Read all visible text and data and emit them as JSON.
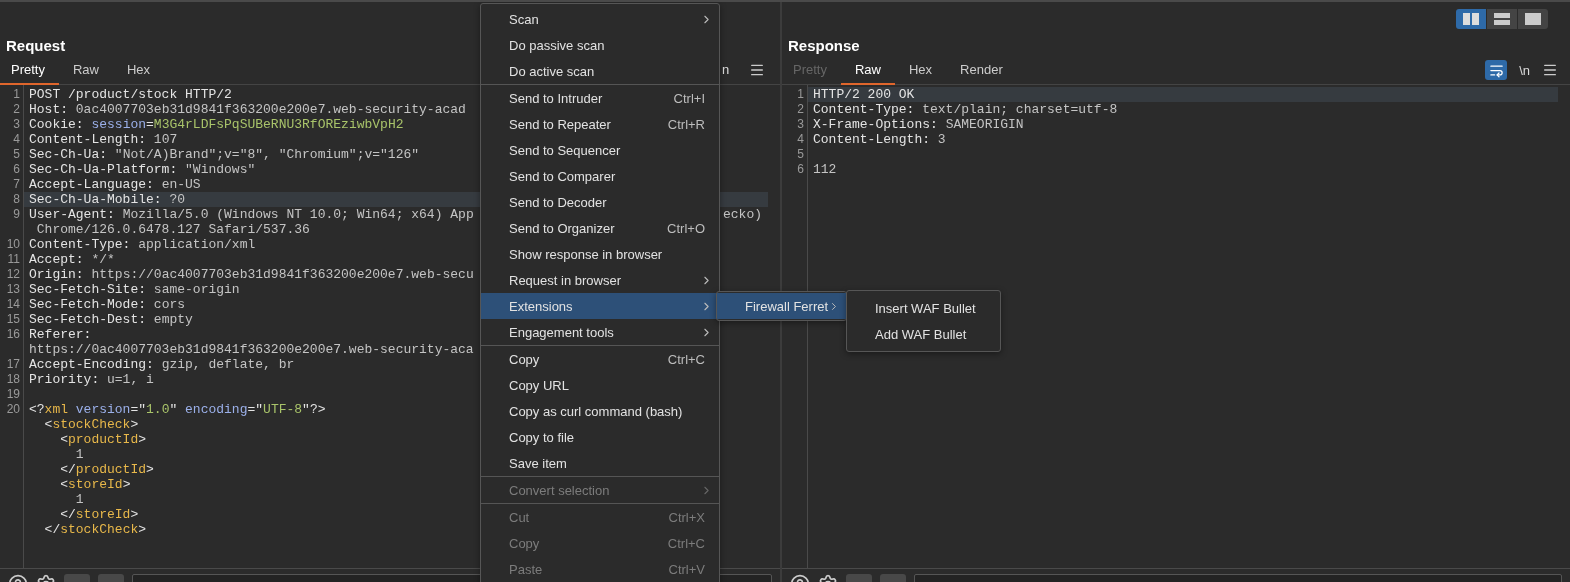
{
  "layout_buttons": [
    {
      "kind": "columns",
      "selected": true
    },
    {
      "kind": "rows",
      "selected": false
    },
    {
      "kind": "single",
      "selected": false
    }
  ],
  "request": {
    "title": "Request",
    "tabs": [
      {
        "label": "Pretty",
        "selected": true,
        "disabled": false
      },
      {
        "label": "Raw",
        "selected": false,
        "disabled": false
      },
      {
        "label": "Hex",
        "selected": false,
        "disabled": false
      }
    ],
    "newline_label": "n",
    "lines": [
      {
        "num": "1",
        "selected": false,
        "segments": [
          {
            "text": "POST /product/stock HTTP/2",
            "kind": "name"
          }
        ]
      },
      {
        "num": "2",
        "selected": false,
        "segments": [
          {
            "text": "Host: ",
            "kind": "name"
          },
          {
            "text": "0ac4007703eb31d9841f363200e200e7.web-security-acad",
            "kind": "value"
          }
        ]
      },
      {
        "num": "3",
        "selected": false,
        "segments": [
          {
            "text": "Cookie: ",
            "kind": "name"
          },
          {
            "text": "session",
            "kind": "blue"
          },
          {
            "text": "=",
            "kind": "name"
          },
          {
            "text": "M3G4rLDFsPqSUBeRNU3RfOREziwbVpH2",
            "kind": "green"
          }
        ]
      },
      {
        "num": "4",
        "selected": false,
        "segments": [
          {
            "text": "Content-Length: ",
            "kind": "name"
          },
          {
            "text": "107",
            "kind": "value"
          }
        ]
      },
      {
        "num": "5",
        "selected": false,
        "segments": [
          {
            "text": "Sec-Ch-Ua: ",
            "kind": "name"
          },
          {
            "text": "\"Not/A)Brand\";v=\"8\", \"Chromium\";v=\"126\"",
            "kind": "value"
          }
        ]
      },
      {
        "num": "6",
        "selected": false,
        "segments": [
          {
            "text": "Sec-Ch-Ua-Platform: ",
            "kind": "name"
          },
          {
            "text": "\"Windows\"",
            "kind": "value"
          }
        ]
      },
      {
        "num": "7",
        "selected": false,
        "segments": [
          {
            "text": "Accept-Language: ",
            "kind": "name"
          },
          {
            "text": "en-US",
            "kind": "value"
          }
        ]
      },
      {
        "num": "8",
        "selected": true,
        "segments": [
          {
            "text": "Sec-Ch-Ua-Mobile: ",
            "kind": "name"
          },
          {
            "text": "?0",
            "kind": "value"
          }
        ]
      },
      {
        "num": "9",
        "selected": false,
        "segments": [
          {
            "text": "User-Agent: ",
            "kind": "name"
          },
          {
            "text": "Mozilla/5.0 (Windows NT 10.0; Win64; x64) App",
            "kind": "value"
          }
        ],
        "tail": "ecko)"
      },
      {
        "selected": false,
        "segments": [
          {
            "text": " Chrome/126.0.6478.127 Safari/537.36",
            "kind": "value"
          }
        ]
      },
      {
        "num": "10",
        "selected": false,
        "segments": [
          {
            "text": "Content-Type: ",
            "kind": "name"
          },
          {
            "text": "application/xml",
            "kind": "value"
          }
        ]
      },
      {
        "num": "11",
        "selected": false,
        "segments": [
          {
            "text": "Accept: ",
            "kind": "name"
          },
          {
            "text": "*/*",
            "kind": "value"
          }
        ]
      },
      {
        "num": "12",
        "selected": false,
        "segments": [
          {
            "text": "Origin: ",
            "kind": "name"
          },
          {
            "text": "https://0ac4007703eb31d9841f363200e200e7.web-secu",
            "kind": "value"
          }
        ]
      },
      {
        "num": "13",
        "selected": false,
        "segments": [
          {
            "text": "Sec-Fetch-Site: ",
            "kind": "name"
          },
          {
            "text": "same-origin",
            "kind": "value"
          }
        ]
      },
      {
        "num": "14",
        "selected": false,
        "segments": [
          {
            "text": "Sec-Fetch-Mode: ",
            "kind": "name"
          },
          {
            "text": "cors",
            "kind": "value"
          }
        ]
      },
      {
        "num": "15",
        "selected": false,
        "segments": [
          {
            "text": "Sec-Fetch-Dest: ",
            "kind": "name"
          },
          {
            "text": "empty",
            "kind": "value"
          }
        ]
      },
      {
        "num": "16",
        "selected": false,
        "segments": [
          {
            "text": "Referer:",
            "kind": "name"
          }
        ]
      },
      {
        "selected": false,
        "segments": [
          {
            "text": "https://0ac4007703eb31d9841f363200e200e7.web-security-aca",
            "kind": "value"
          }
        ]
      },
      {
        "num": "17",
        "selected": false,
        "segments": [
          {
            "text": "Accept-Encoding: ",
            "kind": "name"
          },
          {
            "text": "gzip, deflate, br",
            "kind": "value"
          }
        ]
      },
      {
        "num": "18",
        "selected": false,
        "segments": [
          {
            "text": "Priority: ",
            "kind": "name"
          },
          {
            "text": "u=1, i",
            "kind": "value"
          }
        ]
      },
      {
        "num": "19",
        "selected": false
      },
      {
        "num": "20",
        "selected": false,
        "segments": [
          {
            "text": "<?",
            "kind": "name"
          },
          {
            "text": "xml",
            "kind": "tag"
          },
          {
            "text": " version",
            "kind": "blue"
          },
          {
            "text": "=\"",
            "kind": "name"
          },
          {
            "text": "1.0",
            "kind": "green"
          },
          {
            "text": "\" ",
            "kind": "name"
          },
          {
            "text": "encoding",
            "kind": "blue"
          },
          {
            "text": "=\"",
            "kind": "name"
          },
          {
            "text": "UTF-8",
            "kind": "green"
          },
          {
            "text": "\"?>",
            "kind": "name"
          }
        ]
      },
      {
        "selected": false,
        "segments": [
          {
            "text": "  <",
            "kind": "name"
          },
          {
            "text": "stockCheck",
            "kind": "tag"
          },
          {
            "text": ">",
            "kind": "name"
          }
        ]
      },
      {
        "selected": false,
        "segments": [
          {
            "text": "    <",
            "kind": "name"
          },
          {
            "text": "productId",
            "kind": "tag"
          },
          {
            "text": ">",
            "kind": "name"
          }
        ]
      },
      {
        "selected": false,
        "segments": [
          {
            "text": "      1",
            "kind": "value"
          }
        ]
      },
      {
        "selected": false,
        "segments": [
          {
            "text": "    </",
            "kind": "name"
          },
          {
            "text": "productId",
            "kind": "tag"
          },
          {
            "text": ">",
            "kind": "name"
          }
        ]
      },
      {
        "selected": false,
        "segments": [
          {
            "text": "    <",
            "kind": "name"
          },
          {
            "text": "storeId",
            "kind": "tag"
          },
          {
            "text": ">",
            "kind": "name"
          }
        ]
      },
      {
        "selected": false,
        "segments": [
          {
            "text": "      1",
            "kind": "value"
          }
        ]
      },
      {
        "selected": false,
        "segments": [
          {
            "text": "    </",
            "kind": "name"
          },
          {
            "text": "storeId",
            "kind": "tag"
          },
          {
            "text": ">",
            "kind": "name"
          }
        ]
      },
      {
        "selected": false,
        "segments": [
          {
            "text": "  </",
            "kind": "name"
          },
          {
            "text": "stockCheck",
            "kind": "tag"
          },
          {
            "text": ">",
            "kind": "name"
          }
        ]
      }
    ]
  },
  "response": {
    "title": "Response",
    "tabs": [
      {
        "label": "Pretty",
        "selected": false,
        "disabled": true
      },
      {
        "label": "Raw",
        "selected": true,
        "disabled": false
      },
      {
        "label": "Hex",
        "selected": false,
        "disabled": false
      },
      {
        "label": "Render",
        "selected": false,
        "disabled": false
      }
    ],
    "wrap_on": true,
    "newline_label": "\\n",
    "lines": [
      {
        "num": "1",
        "selected": true,
        "segments": [
          {
            "text": "HTTP/2 200 OK",
            "kind": "name"
          }
        ]
      },
      {
        "num": "2",
        "selected": false,
        "segments": [
          {
            "text": "Content-Type: ",
            "kind": "name"
          },
          {
            "text": "text/plain; charset=utf-8",
            "kind": "value"
          }
        ]
      },
      {
        "num": "3",
        "selected": false,
        "segments": [
          {
            "text": "X-Frame-Options: ",
            "kind": "name"
          },
          {
            "text": "SAMEORIGIN",
            "kind": "value"
          }
        ]
      },
      {
        "num": "4",
        "selected": false,
        "segments": [
          {
            "text": "Content-Length: ",
            "kind": "name"
          },
          {
            "text": "3",
            "kind": "value"
          }
        ]
      },
      {
        "num": "5",
        "selected": false
      },
      {
        "num": "6",
        "selected": false,
        "segments": [
          {
            "text": "112",
            "kind": "value"
          }
        ]
      }
    ]
  },
  "context_menu": {
    "items": [
      {
        "kind": "item",
        "label": "Scan",
        "submenu": true,
        "selected": false,
        "disabled": false
      },
      {
        "kind": "item",
        "label": "Do passive scan",
        "selected": false,
        "disabled": false
      },
      {
        "kind": "item",
        "label": "Do active scan",
        "selected": false,
        "disabled": false
      },
      {
        "kind": "separator"
      },
      {
        "kind": "item",
        "label": "Send to Intruder",
        "shortcut": "Ctrl+I",
        "selected": false,
        "disabled": false
      },
      {
        "kind": "item",
        "label": "Send to Repeater",
        "shortcut": "Ctrl+R",
        "selected": false,
        "disabled": false
      },
      {
        "kind": "item",
        "label": "Send to Sequencer",
        "selected": false,
        "disabled": false
      },
      {
        "kind": "item",
        "label": "Send to Comparer",
        "selected": false,
        "disabled": false
      },
      {
        "kind": "item",
        "label": "Send to Decoder",
        "selected": false,
        "disabled": false
      },
      {
        "kind": "item",
        "label": "Send to Organizer",
        "shortcut": "Ctrl+O",
        "selected": false,
        "disabled": false
      },
      {
        "kind": "item",
        "label": "Show response in browser",
        "selected": false,
        "disabled": false
      },
      {
        "kind": "item",
        "label": "Request in browser",
        "submenu": true,
        "selected": false,
        "disabled": false
      },
      {
        "kind": "item",
        "label": "Extensions",
        "submenu": true,
        "selected": true,
        "disabled": false
      },
      {
        "kind": "item",
        "label": "Engagement tools",
        "submenu": true,
        "selected": false,
        "disabled": false
      },
      {
        "kind": "separator"
      },
      {
        "kind": "item",
        "label": "Copy",
        "shortcut": "Ctrl+C",
        "selected": false,
        "disabled": false
      },
      {
        "kind": "item",
        "label": "Copy URL",
        "selected": false,
        "disabled": false
      },
      {
        "kind": "item",
        "label": "Copy as curl command (bash)",
        "selected": false,
        "disabled": false
      },
      {
        "kind": "item",
        "label": "Copy to file",
        "selected": false,
        "disabled": false
      },
      {
        "kind": "item",
        "label": "Save item",
        "selected": false,
        "disabled": false
      },
      {
        "kind": "separator"
      },
      {
        "kind": "item",
        "label": "Convert selection",
        "submenu": true,
        "selected": false,
        "disabled": true
      },
      {
        "kind": "separator"
      },
      {
        "kind": "item",
        "label": "Cut",
        "shortcut": "Ctrl+X",
        "selected": false,
        "disabled": true
      },
      {
        "kind": "item",
        "label": "Copy",
        "shortcut": "Ctrl+C",
        "selected": false,
        "disabled": true
      },
      {
        "kind": "item",
        "label": "Paste",
        "shortcut": "Ctrl+V",
        "selected": false,
        "disabled": true
      }
    ]
  },
  "extensions_menu": {
    "items": [
      {
        "kind": "item",
        "label": "Firewall Ferret",
        "submenu": true,
        "selected": true,
        "disabled": false
      }
    ]
  },
  "firewall_ferret_menu": {
    "items": [
      {
        "kind": "item",
        "label": "Insert WAF Bullet",
        "selected": false,
        "disabled": false
      },
      {
        "kind": "item",
        "label": "Add WAF Bullet",
        "selected": false,
        "disabled": false
      }
    ]
  }
}
